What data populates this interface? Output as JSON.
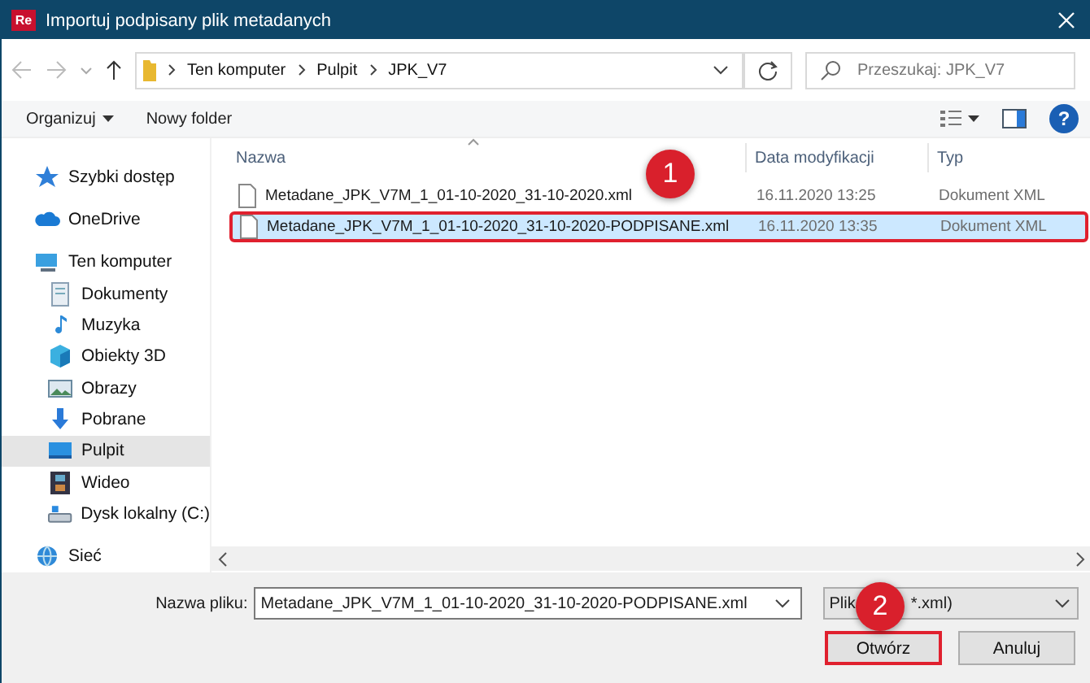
{
  "window": {
    "title": "Importuj podpisany plik metadanych",
    "app_icon": "Re"
  },
  "address": {
    "path": [
      "Ten komputer",
      "Pulpit",
      "JPK_V7"
    ],
    "search_placeholder": "Przeszukaj: JPK_V7"
  },
  "toolbar": {
    "organize": "Organizuj",
    "new_folder": "Nowy folder",
    "help": "?"
  },
  "sidebar": {
    "items": [
      {
        "label": "Szybki dostęp",
        "selected": false
      },
      {
        "label": "OneDrive",
        "selected": false
      },
      {
        "label": "Ten komputer",
        "selected": false,
        "children": [
          {
            "label": "Dokumenty",
            "selected": false
          },
          {
            "label": "Muzyka",
            "selected": false
          },
          {
            "label": "Obiekty 3D",
            "selected": false
          },
          {
            "label": "Obrazy",
            "selected": false
          },
          {
            "label": "Pobrane",
            "selected": false
          },
          {
            "label": "Pulpit",
            "selected": true
          },
          {
            "label": "Wideo",
            "selected": false
          },
          {
            "label": "Dysk lokalny (C:)",
            "selected": false
          }
        ]
      },
      {
        "label": "Sieć",
        "selected": false
      }
    ]
  },
  "table": {
    "columns": [
      "Nazwa",
      "Data modyfikacji",
      "Typ"
    ],
    "rows": [
      {
        "name": "Metadane_JPK_V7M_1_01-10-2020_31-10-2020.xml",
        "modified": "16.11.2020 13:25",
        "type": "Dokument XML",
        "selected": false
      },
      {
        "name": "Metadane_JPK_V7M_1_01-10-2020_31-10-2020-PODPISANE.xml",
        "modified": "16.11.2020 13:35",
        "type": "Dokument XML",
        "selected": true
      }
    ]
  },
  "footer": {
    "filename_label": "Nazwa pliku:",
    "filename": "Metadane_JPK_V7M_1_01-10-2020_31-10-2020-PODPISANE.xml",
    "filter_visible": [
      "Plik",
      "*.xml)"
    ],
    "buttons": [
      "Otwórz",
      "Anuluj"
    ]
  },
  "annotations": [
    {
      "label": "1"
    },
    {
      "label": "2"
    }
  ]
}
